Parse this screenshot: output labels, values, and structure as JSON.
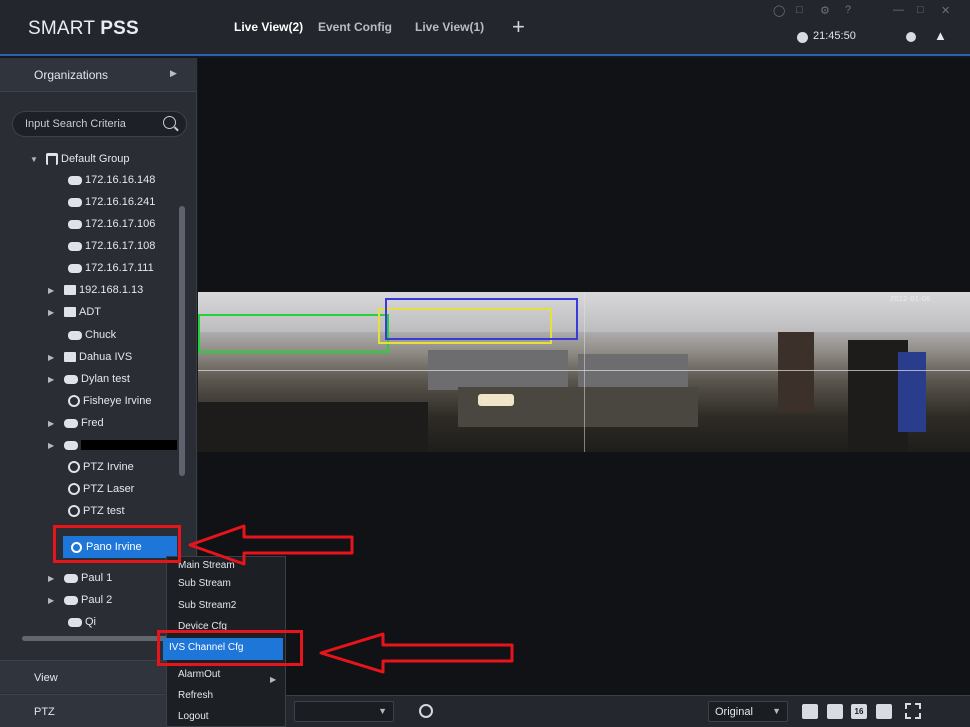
{
  "titlebar": {
    "logo_light": "SMART ",
    "logo_bold": "PSS",
    "tabs": [
      "Live View(2)",
      "Event Config",
      "Live View(1)"
    ],
    "add_tab": "+",
    "clock": "21:45:50"
  },
  "sidebar": {
    "organizations_label": "Organizations",
    "search_placeholder": "Input Search Criteria",
    "tree": {
      "group": "Default Group",
      "items": [
        "172.16.16.148",
        "172.16.16.241",
        "172.16.17.106",
        "172.16.17.108",
        "172.16.17.111",
        "192.168.1.13",
        "ADT",
        "Chuck",
        "Dahua IVS",
        "Dylan test",
        "Fisheye Irvine",
        "Fred",
        "PTZ Irvine",
        "PTZ Laser",
        "PTZ test",
        "Pano Irvine",
        "Paul 1",
        "Paul 2",
        "Qi"
      ]
    },
    "view_label": "View",
    "ptz_label": "PTZ"
  },
  "video": {
    "osd": "2022-01-06"
  },
  "context_menu": {
    "items": [
      "Main Stream",
      "Sub Stream",
      "Sub Stream2",
      "Device Cfg",
      "IVS Channel Cfg",
      "AlarmOut",
      "Refresh",
      "Logout"
    ]
  },
  "toolbar": {
    "ratio": "Original",
    "layout_16": "16"
  },
  "colors": {
    "accent": "#1e77d8",
    "annotation": "#e8141b",
    "ivs_green": "#27d13a",
    "ivs_yellow": "#e5e03a",
    "ivs_blue": "#3a3ad8"
  }
}
